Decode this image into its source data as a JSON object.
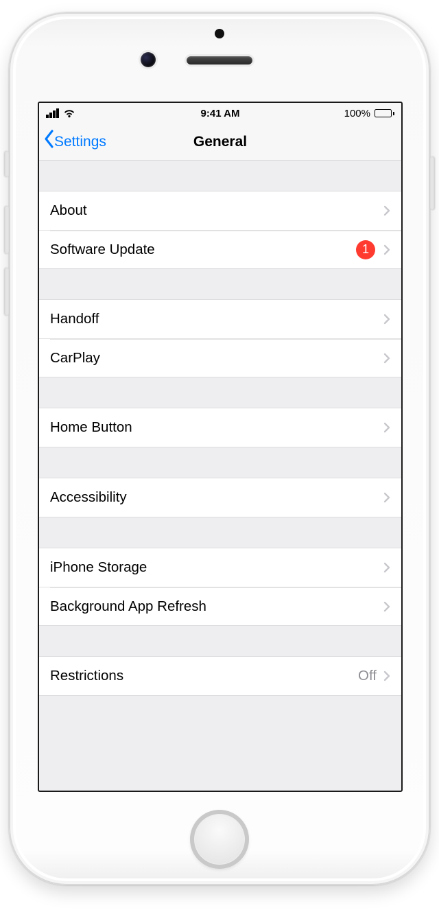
{
  "statusBar": {
    "time": "9:41 AM",
    "batteryText": "100%"
  },
  "nav": {
    "back_label": "Settings",
    "title": "General"
  },
  "sections": [
    {
      "rows": [
        {
          "label": "About",
          "badge": null,
          "value": null
        },
        {
          "label": "Software Update",
          "badge": "1",
          "value": null
        }
      ]
    },
    {
      "rows": [
        {
          "label": "Handoff",
          "badge": null,
          "value": null
        },
        {
          "label": "CarPlay",
          "badge": null,
          "value": null
        }
      ]
    },
    {
      "rows": [
        {
          "label": "Home Button",
          "badge": null,
          "value": null
        }
      ]
    },
    {
      "rows": [
        {
          "label": "Accessibility",
          "badge": null,
          "value": null
        }
      ]
    },
    {
      "rows": [
        {
          "label": "iPhone Storage",
          "badge": null,
          "value": null
        },
        {
          "label": "Background App Refresh",
          "badge": null,
          "value": null
        }
      ]
    },
    {
      "rows": [
        {
          "label": "Restrictions",
          "badge": null,
          "value": "Off"
        }
      ]
    }
  ],
  "colors": {
    "tint": "#007aff",
    "badge": "#ff3b30",
    "separator": "#e3e3e6",
    "background": "#eeeef0"
  }
}
